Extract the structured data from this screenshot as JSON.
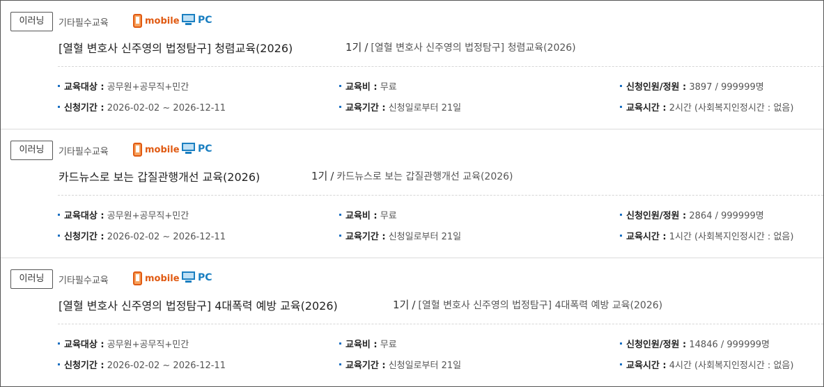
{
  "courses": [
    {
      "badge": "이러닝",
      "category": "기타필수교육",
      "mobile_label": "mobile",
      "pc_label": "PC",
      "title": "[열혈 변호사 신주영의 법정탐구] 청렴교육(2026)",
      "session_gen": "1기",
      "session_slash": "/",
      "session_name": "[열혈 변호사 신주영의 법정탐구] 청렴교육(2026)",
      "target_label": "교육대상 :",
      "target": "공무원+공무직+민간",
      "fee_label": "교육비 :",
      "fee": "무료",
      "capacity_label": "신청인원/정원 :",
      "capacity": "3897 / 999999명",
      "apply_label": "신청기간 :",
      "apply_period": "2026-02-02 ~ 2026-12-11",
      "edu_period_label": "교육기간 :",
      "edu_period": "신청일로부터 21일",
      "edu_time_label": "교육시간 :",
      "edu_time": "2시간 (사회복지인정시간 : 없음)"
    },
    {
      "badge": "이러닝",
      "category": "기타필수교육",
      "mobile_label": "mobile",
      "pc_label": "PC",
      "title": "카드뉴스로 보는 갑질관행개선 교육(2026)",
      "session_gen": "1기",
      "session_slash": "/",
      "session_name": "카드뉴스로 보는 갑질관행개선 교육(2026)",
      "target_label": "교육대상 :",
      "target": "공무원+공무직+민간",
      "fee_label": "교육비 :",
      "fee": "무료",
      "capacity_label": "신청인원/정원 :",
      "capacity": "2864 / 999999명",
      "apply_label": "신청기간 :",
      "apply_period": "2026-02-02 ~ 2026-12-11",
      "edu_period_label": "교육기간 :",
      "edu_period": "신청일로부터 21일",
      "edu_time_label": "교육시간 :",
      "edu_time": "1시간 (사회복지인정시간 : 없음)"
    },
    {
      "badge": "이러닝",
      "category": "기타필수교육",
      "mobile_label": "mobile",
      "pc_label": "PC",
      "title": "[열혈 변호사 신주영의 법정탐구] 4대폭력 예방 교육(2026)",
      "session_gen": "1기",
      "session_slash": "/",
      "session_name": "[열혈 변호사 신주영의 법정탐구] 4대폭력 예방 교육(2026)",
      "target_label": "교육대상 :",
      "target": "공무원+공무직+민간",
      "fee_label": "교육비 :",
      "fee": "무료",
      "capacity_label": "신청인원/정원 :",
      "capacity": "14846 / 999999명",
      "apply_label": "신청기간 :",
      "apply_period": "2026-02-02 ~ 2026-12-11",
      "edu_period_label": "교육기간 :",
      "edu_period": "신청일로부터 21일",
      "edu_time_label": "교육시간 :",
      "edu_time": "4시간 (사회복지인정시간 : 없음)"
    }
  ],
  "colors": {
    "mobile": "#e05a12",
    "pc": "#1a7fc1",
    "bullet": "#1a6fc1"
  },
  "icons": {
    "mobile": "smartphone-icon",
    "pc": "monitor-icon"
  }
}
